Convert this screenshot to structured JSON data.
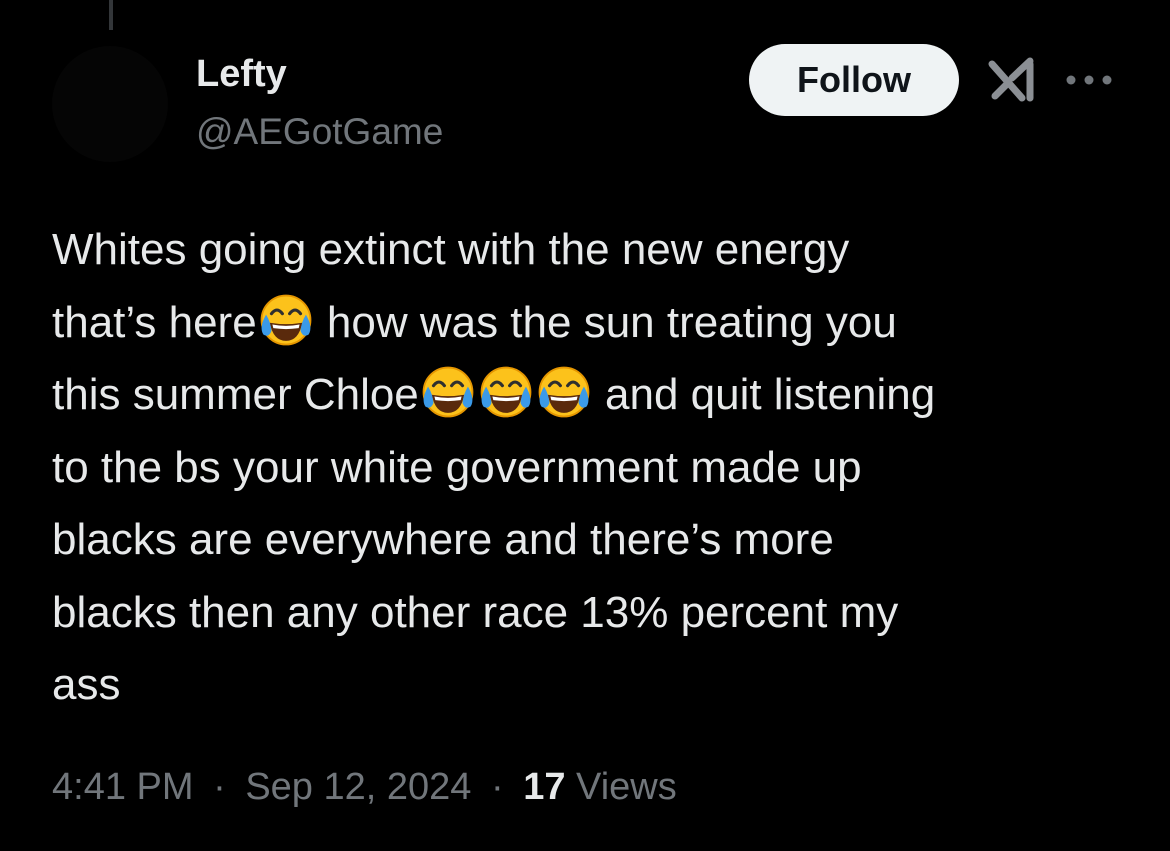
{
  "post": {
    "author": {
      "display_name": "Lefty",
      "handle": "@AEGotGame"
    },
    "follow_label": "Follow",
    "grok_icon": "grok-icon",
    "more_icon": "more-options-icon",
    "text_lines": [
      [
        "Whites going extinct with the new energy"
      ],
      [
        "that’s here",
        "{face-with-tears-of-joy}",
        " how was the sun treating you"
      ],
      [
        "this summer Chloe",
        "{face-with-tears-of-joy}",
        "{face-with-tears-of-joy}",
        "{face-with-tears-of-joy}",
        " and quit listening"
      ],
      [
        "to the bs your white government made up"
      ],
      [
        "blacks are everywhere and there’s more"
      ],
      [
        "blacks then any other race 13% percent my"
      ],
      [
        "ass"
      ]
    ],
    "time": "4:41 PM",
    "separator": "·",
    "date": "Sep 12, 2024",
    "views_count": "17",
    "views_label": "Views"
  },
  "colors": {
    "background": "#000000",
    "primary_text": "#e7e9ea",
    "secondary_text": "#71767b",
    "follow_button_bg": "#eff3f4",
    "follow_button_text": "#0f1419"
  }
}
